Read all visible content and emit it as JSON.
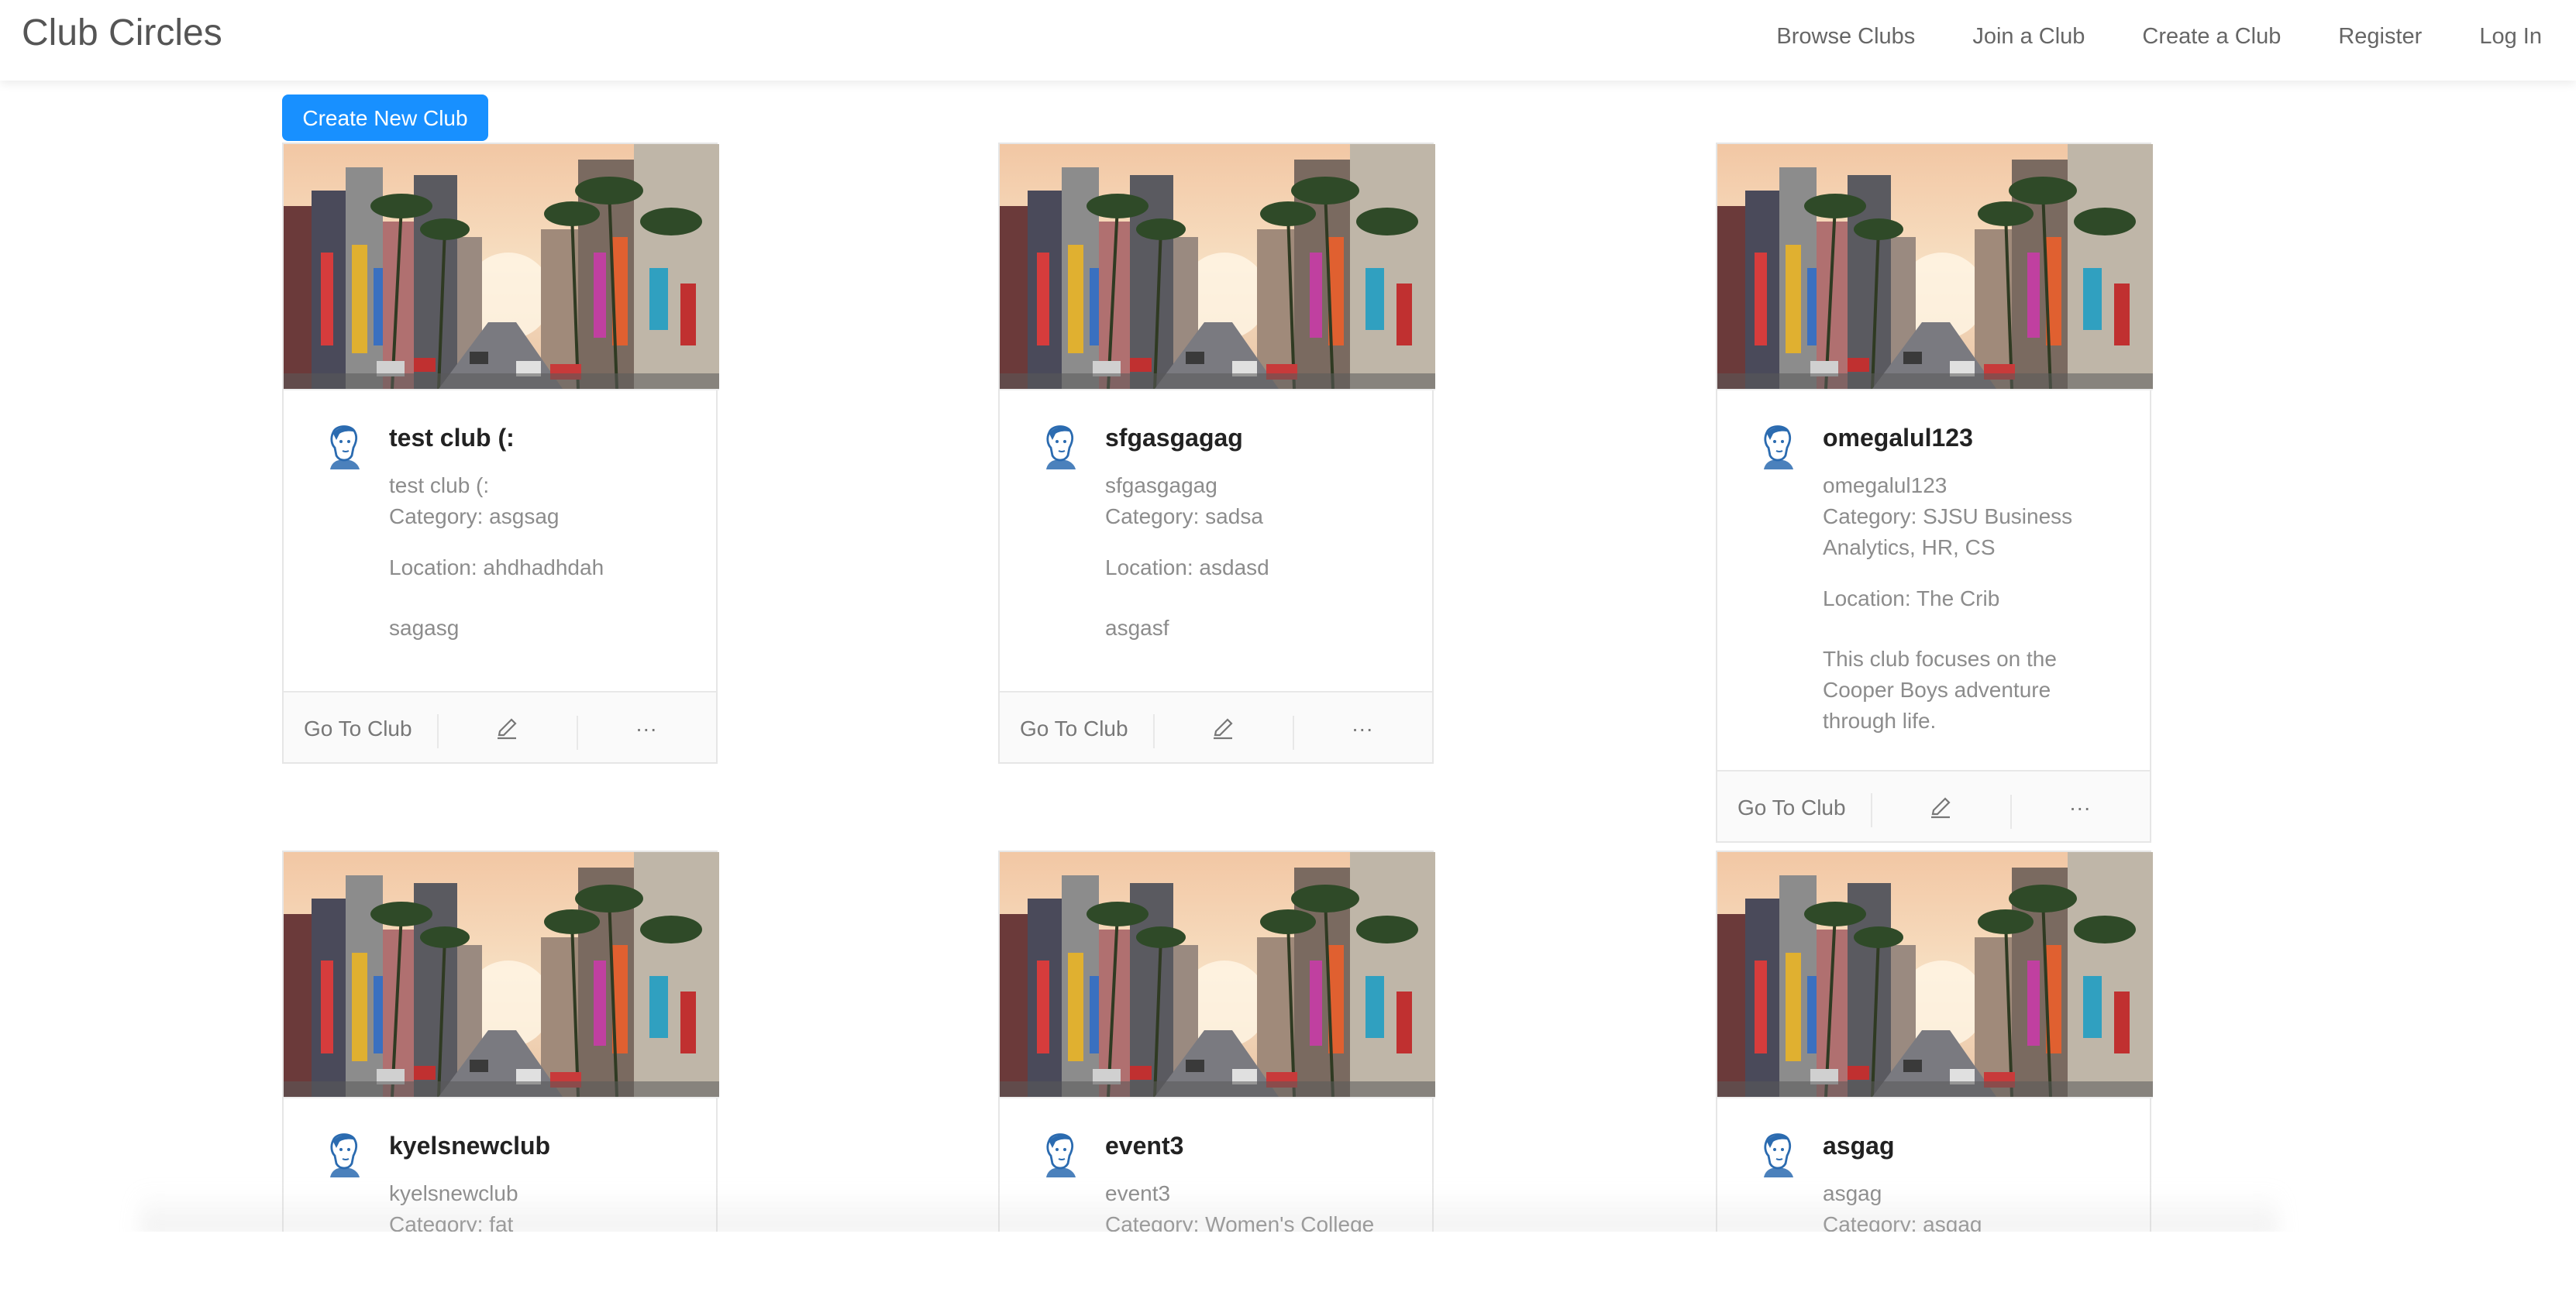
{
  "app": {
    "title": "Club Circles"
  },
  "nav": {
    "items": [
      "Browse Clubs",
      "Join a Club",
      "Create a Club",
      "Register",
      "Log In"
    ]
  },
  "create_button": {
    "label": "Create New Club"
  },
  "card_actions": {
    "goto_label": "Go To Club",
    "edit_icon": "edit-icon",
    "more_icon": "ellipsis-icon"
  },
  "cards": [
    {
      "title": "test club (:",
      "subtitle": "test club (:",
      "category": "Category: asgsag",
      "location": "Location: ahdhadhdah",
      "description": "sagasg"
    },
    {
      "title": "sfgasgagag",
      "subtitle": "sfgasgagag",
      "category": "Category: sadsa",
      "location": "Location: asdasd",
      "description": "asgasf"
    },
    {
      "title": "omegalul123",
      "subtitle": "omegalul123",
      "category": "Category: SJSU Business Analytics, HR, CS",
      "location": "Location: The Crib",
      "description": "This club focuses on the Cooper Boys adventure through life."
    },
    {
      "title": "kyelsnewclub",
      "subtitle": "kyelsnewclub",
      "category": "Category: fat",
      "location": "",
      "description": ""
    },
    {
      "title": "event3",
      "subtitle": "event3",
      "category": "Category: Women's College",
      "location": "",
      "description": ""
    },
    {
      "title": "asgag",
      "subtitle": "asgag",
      "category": "Category: asgag",
      "location": "",
      "description": ""
    }
  ],
  "colors": {
    "primary": "#1890ff",
    "header_text": "#555555",
    "muted_text": "#8c8c8c"
  }
}
